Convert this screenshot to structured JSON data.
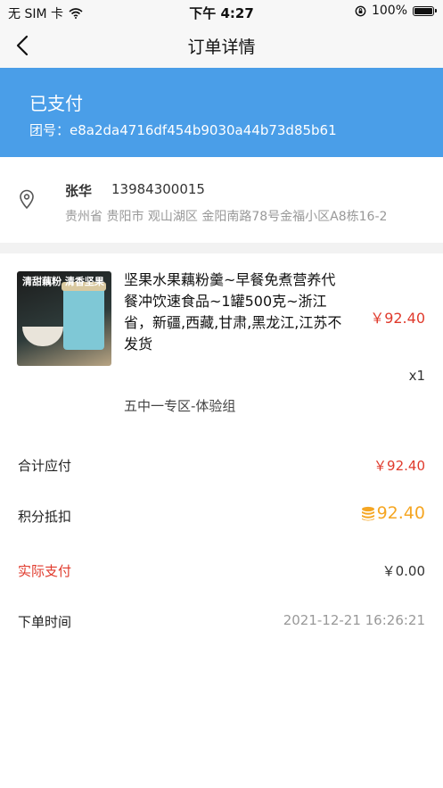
{
  "status_bar": {
    "carrier": "无 SIM 卡",
    "time": "下午 4:27",
    "battery": "100%"
  },
  "nav": {
    "title": "订单详情"
  },
  "order": {
    "status": "已支付",
    "group_label": "团号：",
    "group_id": "e8a2da4716df454b9030a44b73d85b61"
  },
  "address": {
    "name": "张华",
    "phone": "13984300015",
    "detail": "贵州省 贵阳市 观山湖区 金阳南路78号金福小区A8栋16-2"
  },
  "product": {
    "image_text": "清甜藕粉 清香坚果",
    "title": "坚果水果藕粉羹~早餐免煮营养代餐冲饮速食品~1罐500克~浙江省，新疆,西藏,甘肃,黑龙江,江苏不发货",
    "price": "￥92.40",
    "quantity": "x1",
    "spec": "五中一专区-体验组"
  },
  "summary": {
    "total_label": "合计应付",
    "total_value": "￥92.40",
    "points_label": "积分抵扣",
    "points_value": "92.40",
    "paid_label": "实际支付",
    "paid_value": "￥0.00",
    "time_label": "下单时间",
    "time_value": "2021-12-21 16:26:21"
  },
  "colors": {
    "banner": "#4a9ee8",
    "price_red": "#e03a2c",
    "points_orange": "#f5a623"
  },
  "icons": {
    "back": "chevron-left-icon",
    "wifi": "wifi-icon",
    "orientation_lock": "orientation-lock-icon",
    "location": "location-pin-icon",
    "coins": "coin-stack-icon"
  }
}
